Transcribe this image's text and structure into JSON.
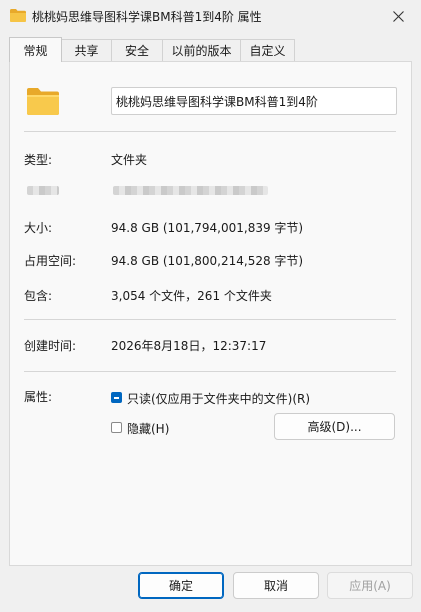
{
  "window": {
    "title": "桃桃妈思维导图科学课BM科普1到4阶 属性",
    "icon": "folder-icon",
    "close_icon": "close-icon"
  },
  "tabs": [
    {
      "label": "常规",
      "active": true
    },
    {
      "label": "共享",
      "active": false
    },
    {
      "label": "安全",
      "active": false
    },
    {
      "label": "以前的版本",
      "active": false
    },
    {
      "label": "自定义",
      "active": false
    }
  ],
  "general": {
    "name_value": "桃桃妈思维导图科学课BM科普1到4阶",
    "type_label": "类型:",
    "type_value": "文件夹",
    "size_label": "大小:",
    "size_value": "94.8 GB (101,794,001,839 字节)",
    "disk_size_label": "占用空间:",
    "disk_size_value": "94.8 GB (101,800,214,528 字节)",
    "contains_label": "包含:",
    "contains_value": "3,054 个文件，261 个文件夹",
    "created_label": "创建时间:",
    "created_value": "2026年8月18日，12:37:17",
    "attributes_label": "属性:",
    "readonly_label": "只读(仅应用于文件夹中的文件)(R)",
    "readonly_state": "mixed",
    "hidden_label": "隐藏(H)",
    "hidden_checked": false,
    "advanced_button": "高级(D)..."
  },
  "footer": {
    "ok": "确定",
    "cancel": "取消",
    "apply": "应用(A)"
  },
  "colors": {
    "accent": "#0067c0",
    "folder": "#f6c445"
  }
}
